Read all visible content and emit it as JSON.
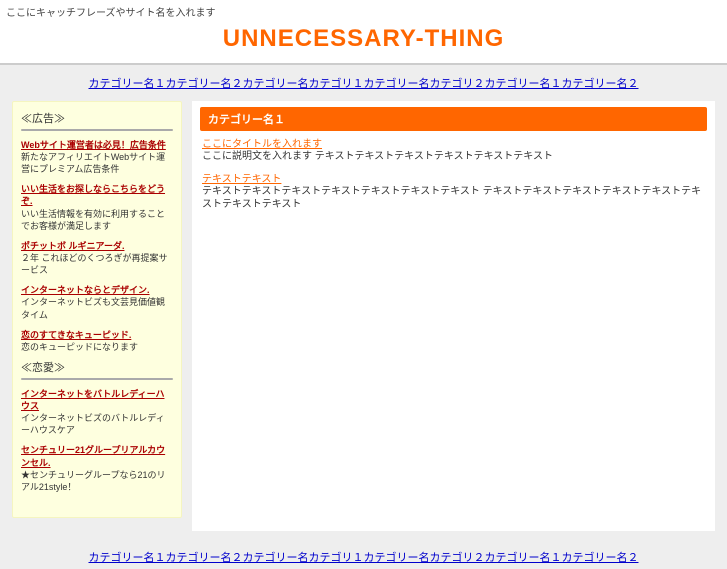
{
  "header": {
    "tagline": "ここにキャッチフレーズやサイト名を入れます",
    "site_title": "UNNECESSARY-THING"
  },
  "nav": {
    "items": [
      "カテゴリー名１",
      "カテゴリー名２",
      "カテゴリー名カテゴリ１",
      "カテゴリー名カテゴリ２",
      "カテゴリー名１",
      "カテゴリー名２"
    ]
  },
  "sidebar": {
    "blocks": [
      {
        "title": "≪広告≫",
        "entries": [
          {
            "h": "Webサイト運営者は必見！広告条件",
            "d": "新たなアフィリエイトWebサイト運営にプレミアム広告条件"
          },
          {
            "h": "いい生活をお探しならこちらをどうぞ.",
            "d": "いい生活情報を有効に利用することでお客様が満足します"
          },
          {
            "h": "ポチットボ ルギニアーダ.",
            "d": "２年 これほどのくつろぎが再提案サービス"
          },
          {
            "h": "インターネットならとデザイン.",
            "d": "インターネットビズも文芸見価値観タイム"
          },
          {
            "h": "恋のすてきなキューピッド.",
            "d": "恋のキューピッドになります"
          }
        ]
      },
      {
        "title": "≪恋愛≫",
        "entries": [
          {
            "h": "インターネットをバトルレディーハウス",
            "d": "インターネットビズのバトルレディーハウスケア"
          },
          {
            "h": "センチュリー21グループリアルカウンセル.",
            "d": "★センチュリーグループなら21のリアル21style！"
          }
        ]
      }
    ]
  },
  "main": {
    "category_label": "カテゴリー名１",
    "sections": [
      {
        "h": "ここにタイトルを入れます",
        "d": "ここに説明文を入れます\nテキストテキストテキストテキストテキストテキスト"
      },
      {
        "h": "テキストテキスト",
        "d": "テキストテキストテキストテキストテキストテキストテキスト\nテキストテキストテキストテキストテキストテキストテキストテキスト"
      }
    ]
  }
}
